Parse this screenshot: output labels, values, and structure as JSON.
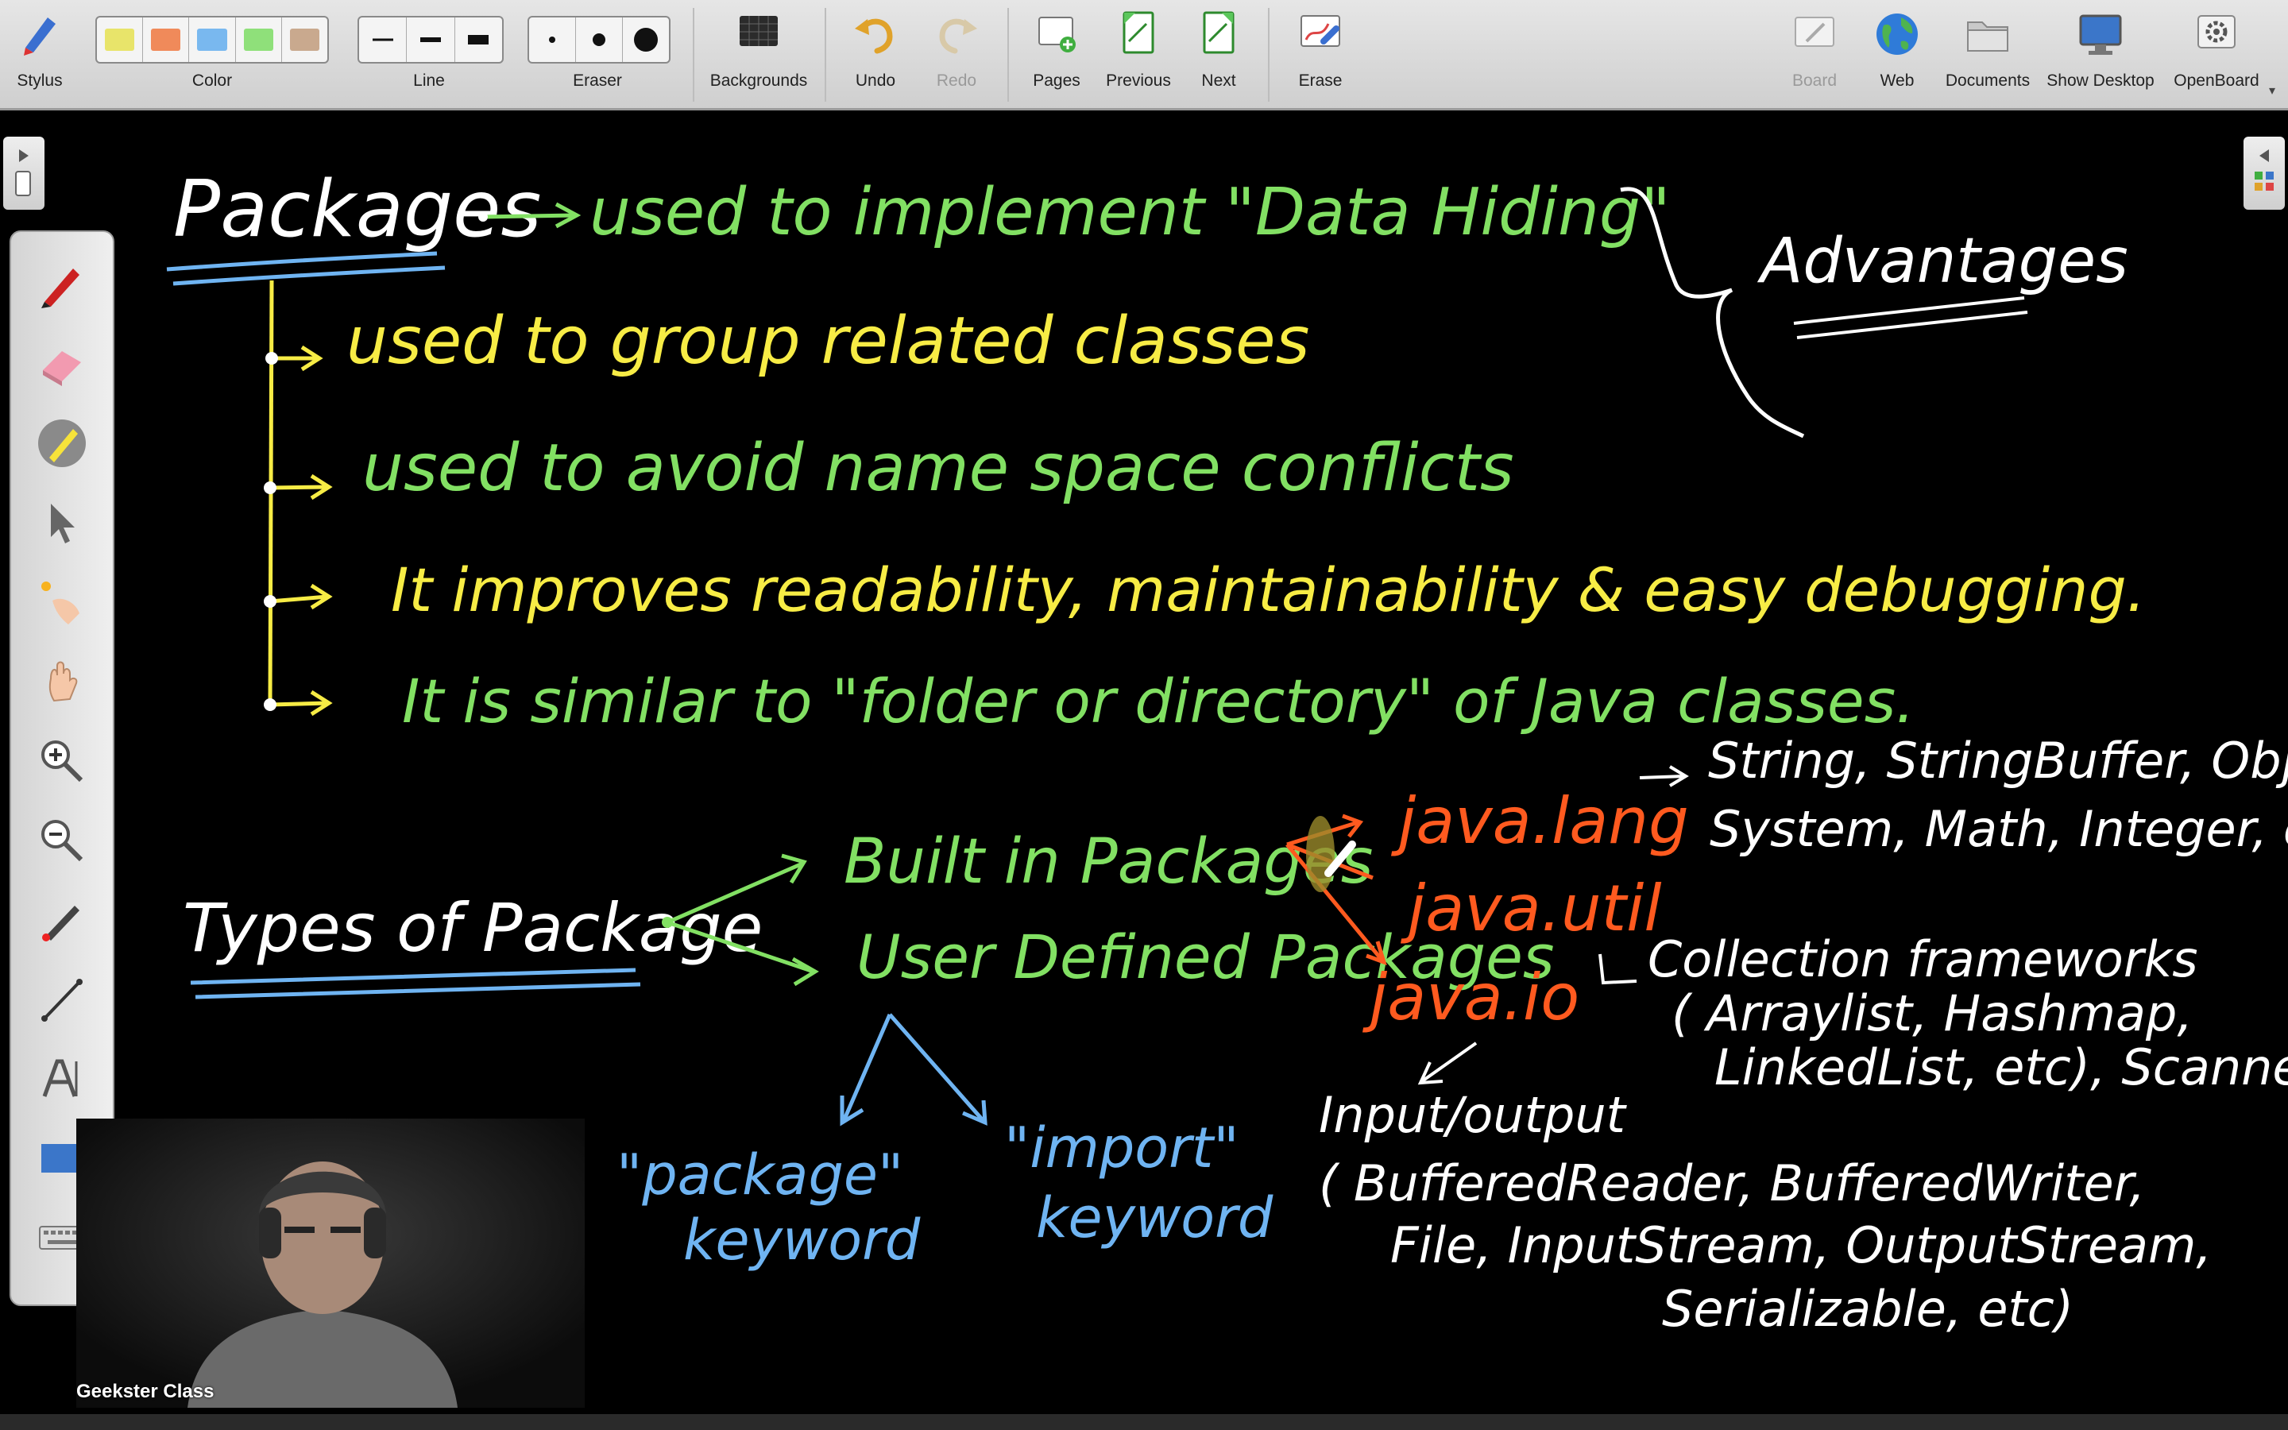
{
  "toolbar": {
    "stylus": "Stylus",
    "color": "Color",
    "line": "Line",
    "eraser": "Eraser",
    "backgrounds": "Backgrounds",
    "undo": "Undo",
    "redo": "Redo",
    "pages": "Pages",
    "previous": "Previous",
    "next": "Next",
    "erase": "Erase",
    "board": "Board",
    "web": "Web",
    "documents": "Documents",
    "show_desktop": "Show Desktop",
    "openboard": "OpenBoard"
  },
  "palette": [
    "#e8e46a",
    "#f08a5a",
    "#79b8ef",
    "#8fe07a",
    "#c9a98e"
  ],
  "ink_colors": {
    "yellow": "#f7ec45",
    "green": "#82e063",
    "white": "#ffffff",
    "blue": "#6fb4f2",
    "orange": "#ff5a1f"
  },
  "board": {
    "packages_title": "Packages",
    "data_hiding": "used to implement \"Data Hiding\"",
    "advantages": "Advantages",
    "points": [
      "used to group related classes",
      "used to avoid name space conflicts",
      "It improves readability, maintainability & easy debugging.",
      "It is similar to \"folder or directory\" of Java classes."
    ],
    "types_title": "Types of Package",
    "builtin": "Built in Packages",
    "userdefined": "User Defined Packages",
    "java_lang": "java.lang",
    "java_lang_classes_1": "String, StringBuffer, Object,",
    "java_lang_classes_2": "System, Math, Integer, etc",
    "java_util": "java.util",
    "java_util_desc_1": "Collection frameworks",
    "java_util_desc_2": "( Arraylist, Hashmap,",
    "java_util_desc_3": "LinkedList, etc), Scanner",
    "java_io": "java.io",
    "io_desc_1": "Input/output",
    "io_desc_2": "( BufferedReader, BufferedWriter,",
    "io_desc_3": "File, InputStream, OutputStream,",
    "io_desc_4": "Serializable, etc)",
    "package_kw_1": "\"package\"",
    "package_kw_2": "keyword",
    "import_kw_1": "\"import\"",
    "import_kw_2": "keyword"
  },
  "webcam": {
    "name": "Geekster Class"
  }
}
